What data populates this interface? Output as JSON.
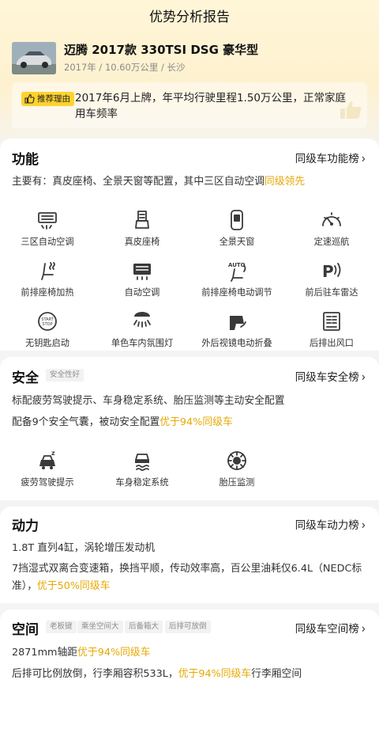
{
  "header": {
    "title": "优势分析报告"
  },
  "car": {
    "name": "迈腾 2017款 330TSI DSG 豪华型",
    "meta": "2017年 / 10.60万公里 / 长沙"
  },
  "recommend": {
    "badge": "推荐理由",
    "text": "2017年6月上牌，年平均行驶里程1.50万公里，正常家庭用车频率"
  },
  "function": {
    "title": "功能",
    "rank_link": "同级车功能榜",
    "desc_prefix": "主要有：真皮座椅、全景天窗等配置，其中三区自动空调",
    "desc_highlight": "同级领先",
    "features": [
      {
        "label": "三区自动空调",
        "icon": "ac-climate-icon"
      },
      {
        "label": "真皮座椅",
        "icon": "leather-seat-icon"
      },
      {
        "label": "全景天窗",
        "icon": "panoramic-sunroof-icon"
      },
      {
        "label": "定速巡航",
        "icon": "cruise-control-icon"
      },
      {
        "label": "前排座椅加热",
        "icon": "seat-heating-icon"
      },
      {
        "label": "自动空调",
        "icon": "auto-ac-icon"
      },
      {
        "label": "前排座椅电动调节",
        "icon": "power-seat-icon"
      },
      {
        "label": "前后驻车雷达",
        "icon": "parking-radar-icon"
      },
      {
        "label": "无钥匙启动",
        "icon": "keyless-start-icon"
      },
      {
        "label": "单色车内氛围灯",
        "icon": "ambient-light-icon"
      },
      {
        "label": "外后视镜电动折叠",
        "icon": "mirror-fold-icon"
      },
      {
        "label": "后排出风口",
        "icon": "rear-vent-icon"
      }
    ]
  },
  "safety": {
    "title": "安全",
    "tag": "安全性好",
    "rank_link": "同级车安全榜",
    "desc1": "标配疲劳驾驶提示、车身稳定系统、胎压监测等主动安全配置",
    "desc2_prefix": "配备9个安全气囊，被动安全配置",
    "desc2_highlight": "优于94%同级车",
    "features": [
      {
        "label": "疲劳驾驶提示",
        "icon": "fatigue-alert-icon"
      },
      {
        "label": "车身稳定系统",
        "icon": "stability-control-icon"
      },
      {
        "label": "胎压监测",
        "icon": "tire-pressure-icon"
      }
    ]
  },
  "power": {
    "title": "动力",
    "rank_link": "同级车动力榜",
    "desc1": "1.8T 直列4缸，涡轮增压发动机",
    "desc2_prefix": "7挡湿式双离合变速箱，换挡平顺，传动效率高，百公里油耗仅6.4L（NEDC标准），",
    "desc2_highlight": "优于50%同级车"
  },
  "space": {
    "title": "空间",
    "tags": [
      "老板键",
      "乘坐空间大",
      "后备箱大",
      "后排可放倒"
    ],
    "rank_link": "同级车空间榜",
    "desc1_prefix": "2871mm轴距",
    "desc1_highlight": "优于94%同级车",
    "desc2_prefix": "后排可比例放倒，行李厢容积533L，",
    "desc2_highlight": "优于94%同级车",
    "desc2_suffix": "行李厢空间"
  },
  "colors": {
    "highlight": "#e6a800",
    "badge": "#ffd22e",
    "icon": "#3a3a3a"
  }
}
